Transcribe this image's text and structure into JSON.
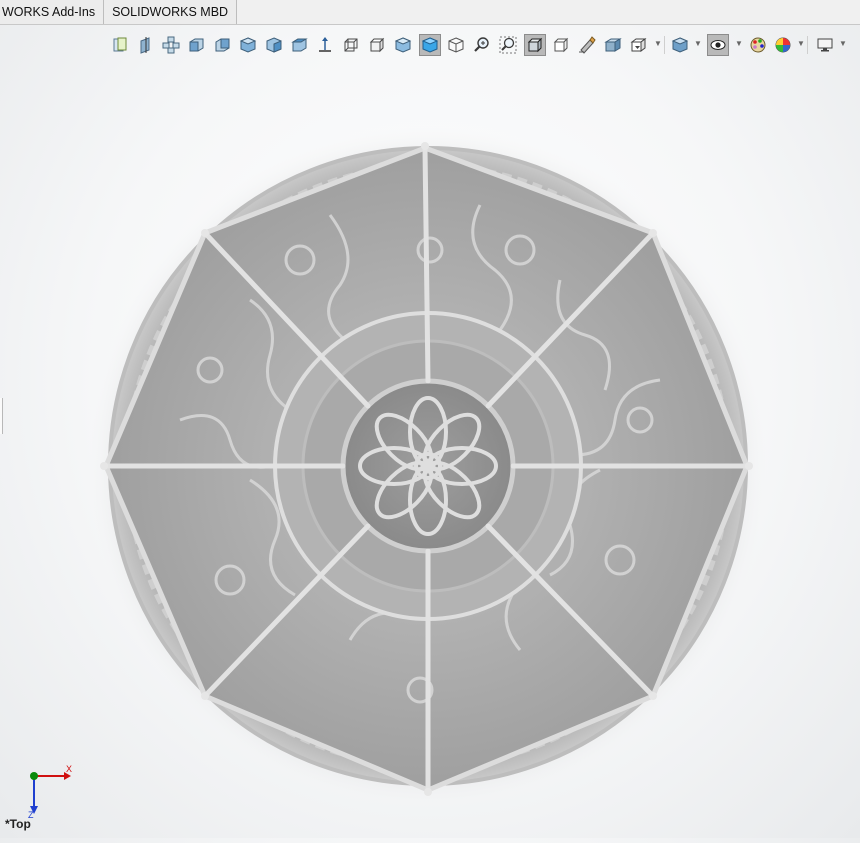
{
  "command_manager": {
    "tabs": [
      {
        "label": "WORKS Add-Ins"
      },
      {
        "label": "SOLIDWORKS MBD"
      }
    ]
  },
  "heads_up_toolbar": {
    "buttons": [
      {
        "icon": "section-view-icon"
      },
      {
        "icon": "front-plane-icon"
      },
      {
        "icon": "view-orientation-icon"
      },
      {
        "icon": "front-view-icon"
      },
      {
        "icon": "back-view-icon"
      },
      {
        "icon": "left-view-icon"
      },
      {
        "icon": "right-view-icon"
      },
      {
        "icon": "top-view-icon"
      },
      {
        "icon": "bottom-view-icon"
      },
      {
        "icon": "isometric-view-icon"
      },
      {
        "icon": "trimetric-view-icon"
      },
      {
        "icon": "dimetric-view-icon"
      },
      {
        "icon": "normal-to-icon",
        "pressed": true
      },
      {
        "icon": "single-view-icon"
      },
      {
        "icon": "zoom-to-fit-icon"
      },
      {
        "icon": "zoom-to-area-icon"
      },
      {
        "icon": "view-selector-icon",
        "pressed": true
      },
      {
        "icon": "display-style-icon"
      },
      {
        "icon": "hide-show-items-icon"
      },
      {
        "icon": "edit-appearance-icon"
      },
      {
        "icon": "apply-scene-icon"
      },
      {
        "icon": "view-settings-icon"
      },
      {
        "icon": "visibility-eye-icon",
        "pressed": true
      },
      {
        "icon": "appearance-palette-icon"
      },
      {
        "icon": "scene-colors-icon"
      },
      {
        "icon": "monitor-display-icon"
      }
    ]
  },
  "graphics_area": {
    "model": "lattice-dome-top-view",
    "ribs": 8,
    "view_name": "*Top",
    "triad": {
      "x_label": "X",
      "z_label": "Z"
    },
    "colors": {
      "model": "#a9a9a9",
      "axis_x": "#d01010",
      "axis_y": "#0a8a0a",
      "axis_z": "#1f3fcf"
    }
  }
}
